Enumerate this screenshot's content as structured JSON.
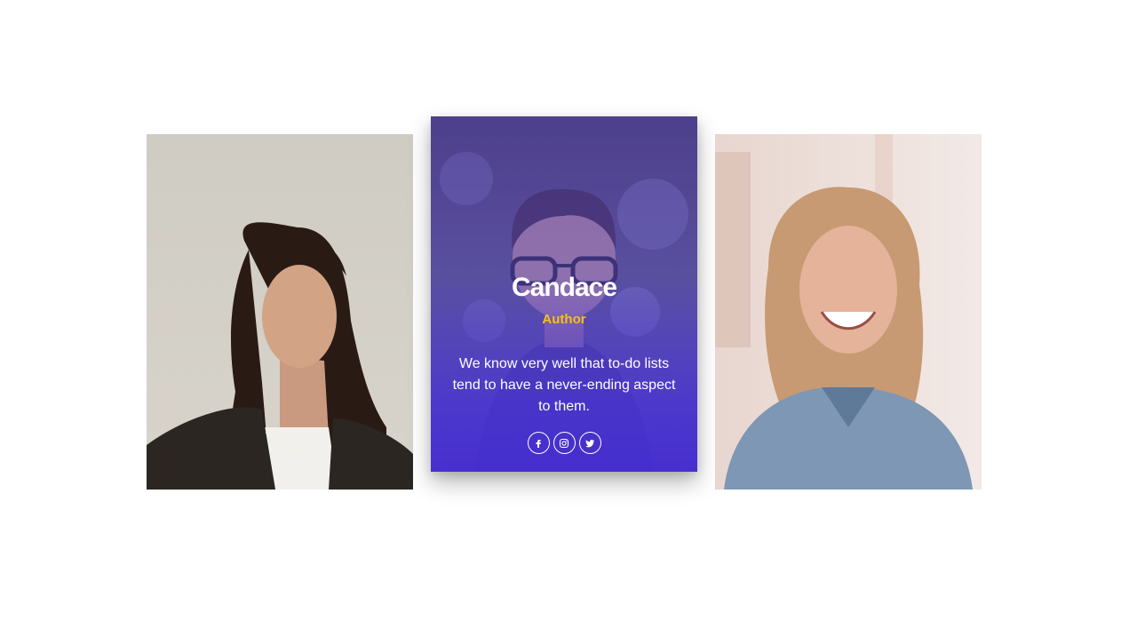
{
  "team": {
    "members": [
      {
        "image": "portrait-woman-curly-hair"
      },
      {
        "image": "portrait-man-glasses",
        "name": "Candace",
        "role": "Author",
        "bio": "We know very well that to-do lists tend to have a never-ending aspect to them.",
        "socials": [
          {
            "icon": "facebook-icon"
          },
          {
            "icon": "instagram-icon"
          },
          {
            "icon": "twitter-icon"
          }
        ]
      },
      {
        "image": "portrait-woman-blonde-denim-jacket"
      }
    ]
  },
  "colors": {
    "overlay": "#4a34d2",
    "role_accent": "#f5c211",
    "text": "#ffffff"
  }
}
